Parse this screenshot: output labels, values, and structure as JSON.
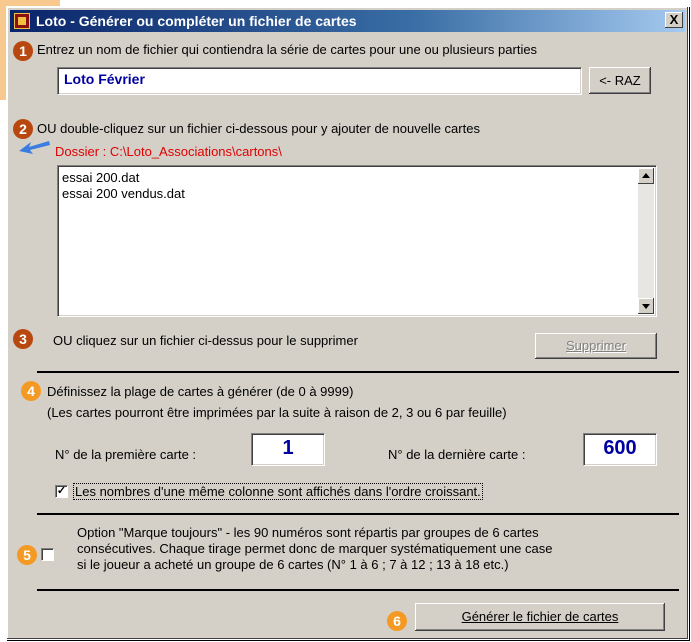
{
  "window": {
    "title": "Loto - Générer ou compléter un fichier de cartes",
    "close_label": "X"
  },
  "step1": {
    "number": "1",
    "instruction": "Entrez un nom de fichier qui contiendra la série de cartes pour une ou plusieurs parties",
    "filename_value": "Loto Février",
    "reset_label": "<- RAZ"
  },
  "step2": {
    "number": "2",
    "instruction": "OU double-cliquez sur un fichier ci-dessous pour y ajouter de nouvelle cartes",
    "folder_label": "Dossier : C:\\Loto_Associations\\cartons\\",
    "files": [
      "essai 200.dat",
      "essai 200  vendus.dat"
    ]
  },
  "step3": {
    "number": "3",
    "instruction": "OU cliquez sur un fichier ci-dessus pour le supprimer",
    "delete_label": "Supprimer"
  },
  "step4": {
    "number": "4",
    "instruction": "Définissez la plage de cartes à générer (de 0 à 9999)",
    "note": "(Les cartes pourront être imprimées par la suite à raison de 2, 3 ou 6 par feuille)",
    "first_label": "N° de la première carte :",
    "first_value": "1",
    "last_label": "N° de la dernière carte :",
    "last_value": "600",
    "sort_checked": true,
    "sort_label": "Les nombres d'une même colonne sont affichés dans l'ordre croissant."
  },
  "step5": {
    "number": "5",
    "checked": false,
    "line1": "Option \"Marque toujours\" - les 90 numéros sont répartis par groupes de 6 cartes",
    "line2": "consécutives. Chaque tirage permet donc de marquer systématiquement une case",
    "line3": "si le joueur a acheté un groupe de 6 cartes (N° 1 à 6 ; 7 à 12 ; 13 à 18 etc.)"
  },
  "step6": {
    "number": "6",
    "generate_label": "Générer le fichier de cartes"
  },
  "colors": {
    "step_dark": "#b8480f",
    "step_light": "#f49a24",
    "folder_text": "#e00000",
    "value_text": "#0000a0"
  }
}
